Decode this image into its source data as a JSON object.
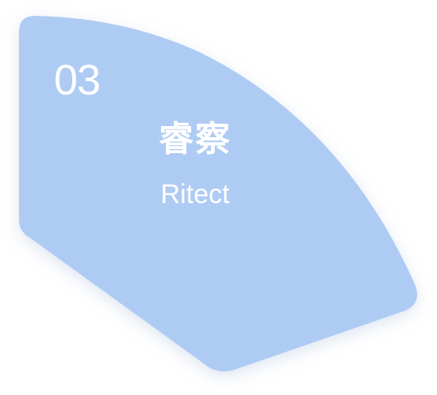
{
  "card": {
    "number": "03",
    "title_cn": "睿察",
    "title_en": "Ritect",
    "fill_color": "#AECBF3",
    "shadow_color": "#9fb6d8",
    "text_color": "#FFFFFF"
  }
}
